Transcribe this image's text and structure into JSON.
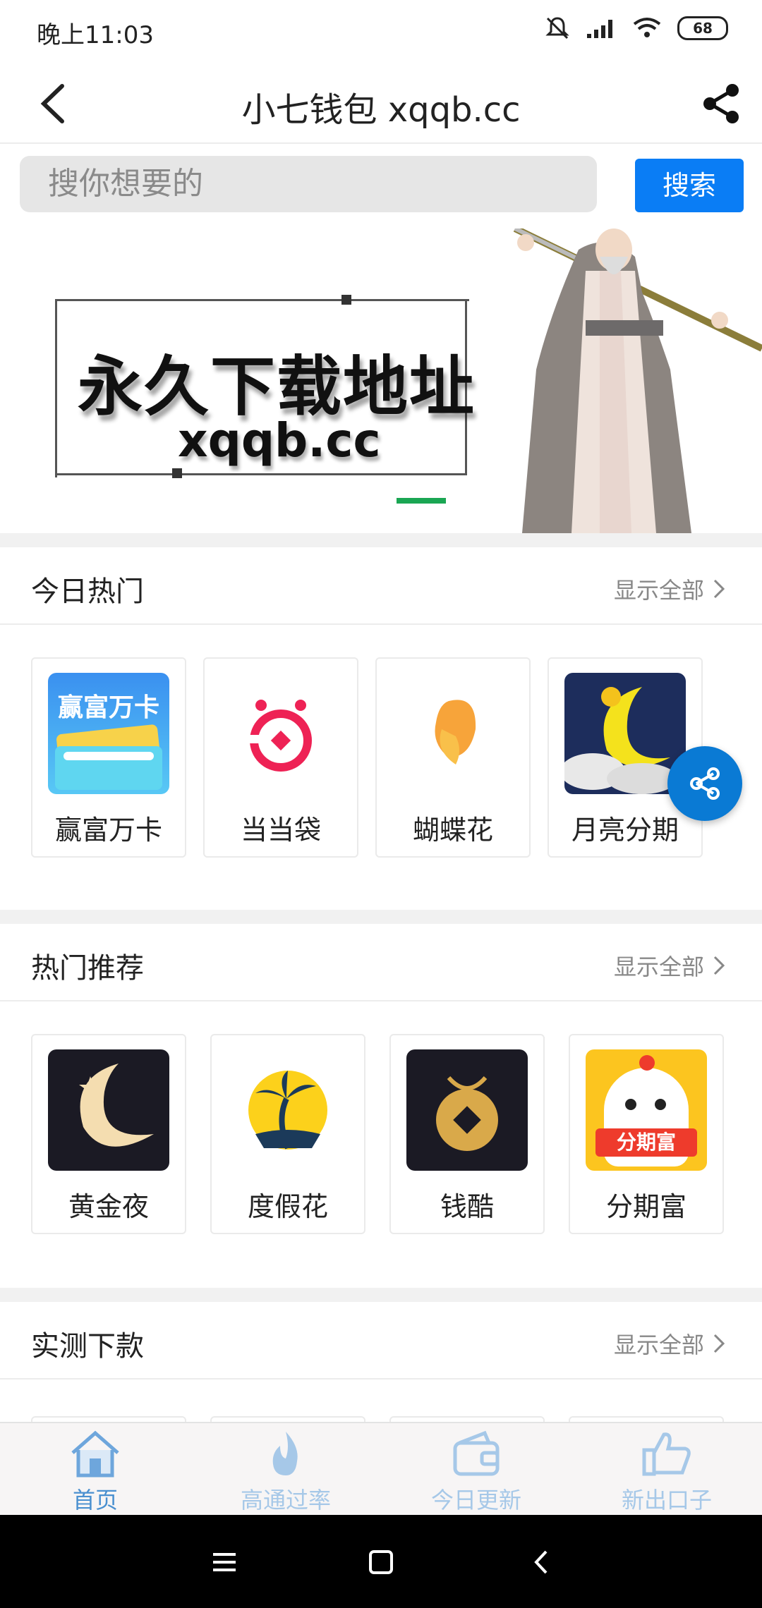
{
  "status_bar": {
    "time": "晚上11:03",
    "battery": "68"
  },
  "header": {
    "title": "小七钱包 xqqb.cc"
  },
  "search": {
    "placeholder": "搜你想要的",
    "button_label": "搜索"
  },
  "banner": {
    "headline": "永久下载地址",
    "url": "xqqb.cc"
  },
  "sections": [
    {
      "title": "今日热门",
      "more_label": "显示全部",
      "items": [
        {
          "label": "赢富万卡",
          "icon": "yingfu-card-icon",
          "icon_text": "赢富万卡"
        },
        {
          "label": "当当袋",
          "icon": "dangdang-bag-icon"
        },
        {
          "label": "蝴蝶花",
          "icon": "butterfly-flower-icon"
        },
        {
          "label": "月亮分期",
          "icon": "moon-installment-icon"
        }
      ]
    },
    {
      "title": "热门推荐",
      "more_label": "显示全部",
      "items": [
        {
          "label": "黄金夜",
          "icon": "golden-night-moon-icon"
        },
        {
          "label": "度假花",
          "icon": "palm-island-icon"
        },
        {
          "label": "钱酷",
          "icon": "coin-icon"
        },
        {
          "label": "分期富",
          "icon": "chick-icon",
          "icon_text": "分期富"
        }
      ]
    },
    {
      "title": "实测下款",
      "more_label": "显示全部",
      "items": []
    }
  ],
  "tab_bar": [
    {
      "label": "首页",
      "icon": "home-icon",
      "active": true
    },
    {
      "label": "高通过率",
      "icon": "flame-icon",
      "active": false
    },
    {
      "label": "今日更新",
      "icon": "wallet-icon",
      "active": false
    },
    {
      "label": "新出口子",
      "icon": "thumbs-up-icon",
      "active": false
    }
  ],
  "colors": {
    "accent": "#0a7df5",
    "fab": "#0a7ad4",
    "tab_active": "#4a90d0",
    "tab_inactive": "#a6c8e8",
    "banner_indicator": "#1aa653"
  }
}
